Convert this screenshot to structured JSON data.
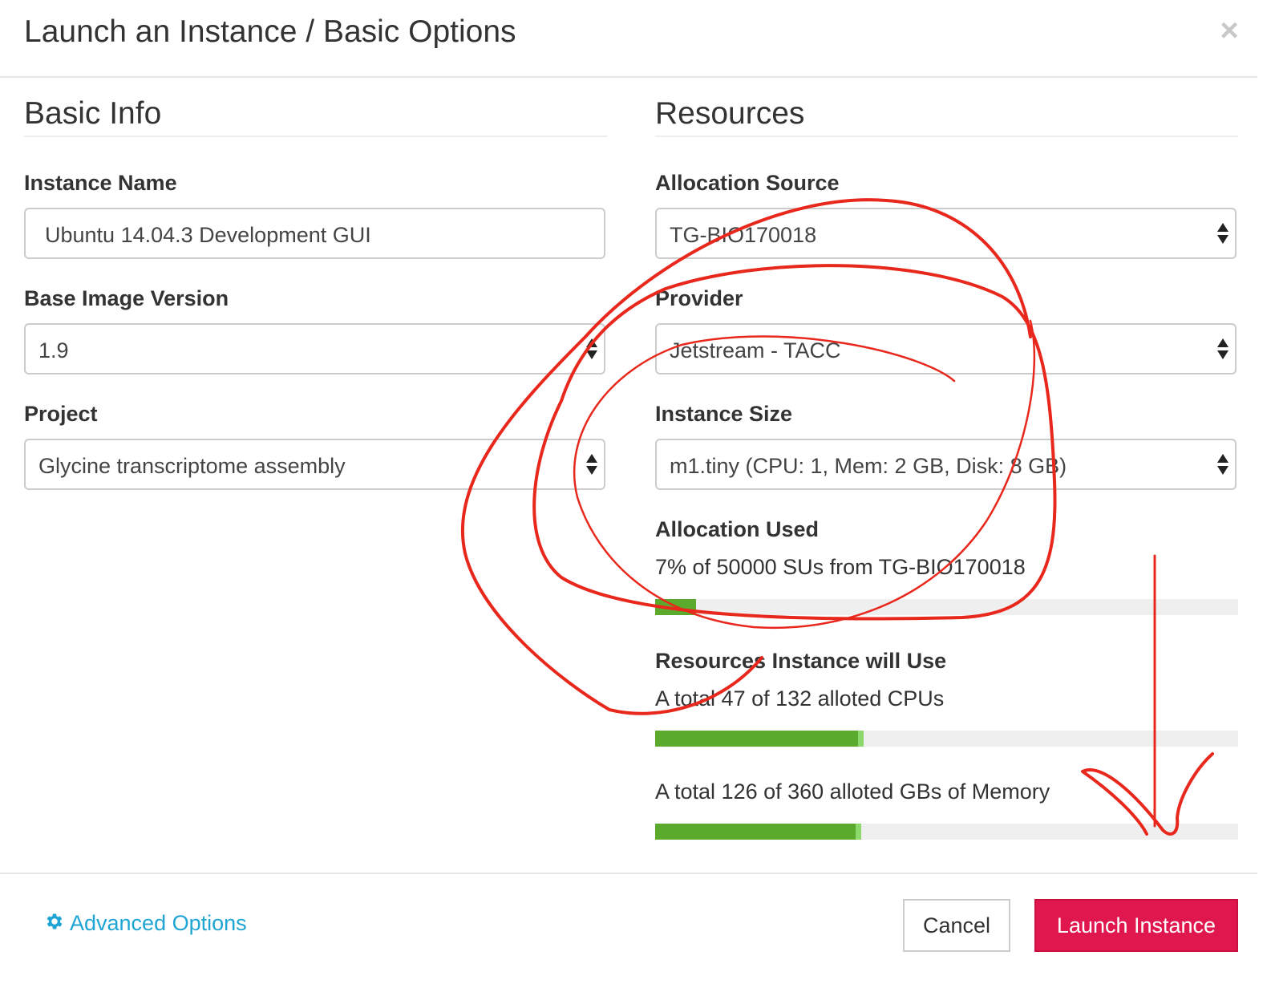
{
  "modal": {
    "title": "Launch an Instance / Basic Options",
    "close_icon": "×"
  },
  "basic_info": {
    "heading": "Basic Info",
    "instance_name": {
      "label": "Instance Name",
      "value": "Ubuntu 14.04.3 Development GUI"
    },
    "base_image_version": {
      "label": "Base Image Version",
      "value": "1.9"
    },
    "project": {
      "label": "Project",
      "value": "Glycine transcriptome assembly"
    }
  },
  "resources": {
    "heading": "Resources",
    "allocation_source": {
      "label": "Allocation Source",
      "value": "TG-BIO170018"
    },
    "provider": {
      "label": "Provider",
      "value": "Jetstream - TACC"
    },
    "instance_size": {
      "label": "Instance Size",
      "value": "m1.tiny (CPU: 1, Mem: 2 GB, Disk: 8 GB)"
    },
    "allocation_used": {
      "label": "Allocation Used",
      "text": "7% of 50000 SUs from TG-BIO170018",
      "percent": 7
    },
    "instance_use": {
      "label": "Resources Instance will Use",
      "cpu_text": "A total 47 of 132 alloted CPUs",
      "cpu_used": 46,
      "cpu_new": 1,
      "cpu_total": 132,
      "memory_text": "A total 126 of 360 alloted GBs of Memory",
      "memory_used": 124,
      "memory_new": 2,
      "memory_total": 360
    }
  },
  "footer": {
    "advanced_options": "Advanced Options",
    "cancel": "Cancel",
    "launch": "Launch Instance"
  },
  "icons": {
    "gear": "gear-icon",
    "caret": "select-caret-icon",
    "close": "close-icon"
  },
  "colors": {
    "progress_fill": "#5aab2d",
    "progress_new": "#8cd86a",
    "launch_button": "#e0174e",
    "link": "#1fa5d4",
    "annotation": "#e8281c"
  }
}
